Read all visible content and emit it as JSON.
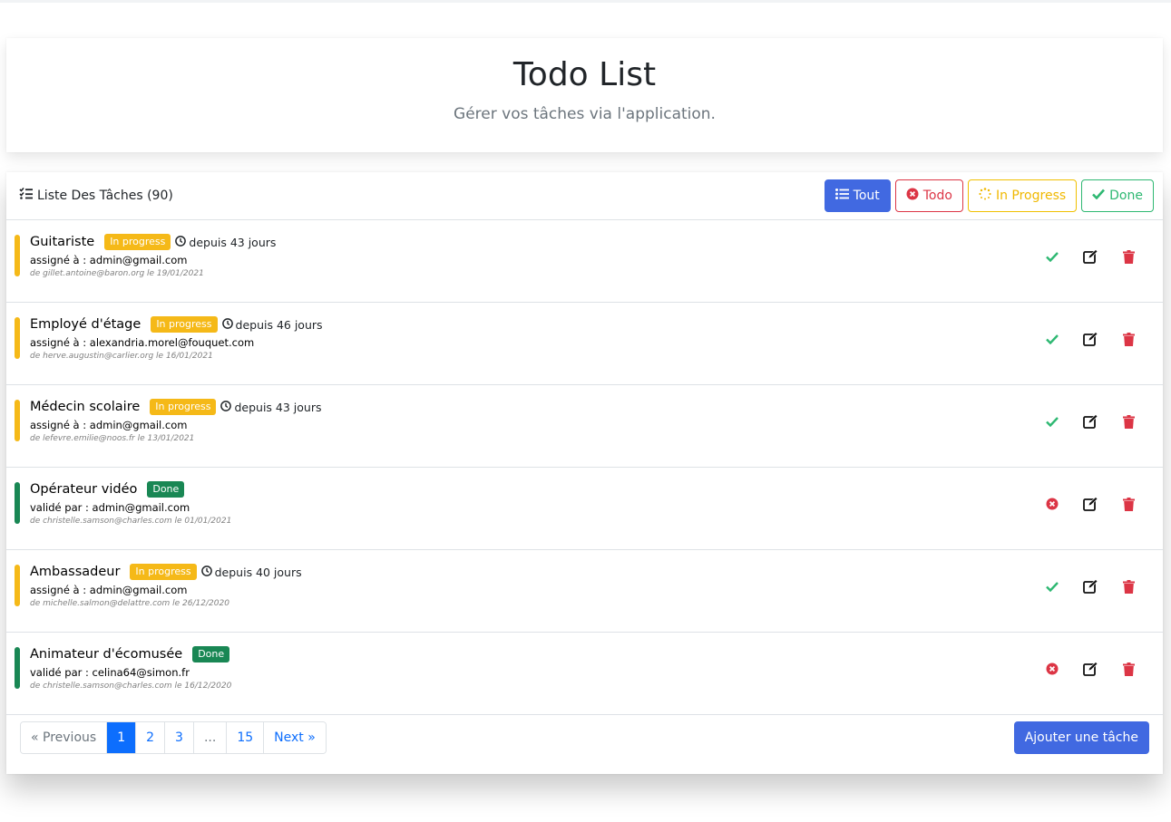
{
  "header": {
    "title": "Todo List",
    "subtitle": "Gérer vos tâches via l'application."
  },
  "tasks_panel": {
    "title": "Liste Des Tâches (90)",
    "title_icon": "tasks-list-icon",
    "filters": {
      "all": "Tout",
      "todo": "Todo",
      "in_progress": "In Progress",
      "done": "Done"
    },
    "colors": {
      "primary": "#4169e1",
      "danger": "#dc3545",
      "warning": "#f5b918",
      "success": "#198754",
      "check": "#2eb872"
    }
  },
  "tasks": [
    {
      "title": "Guitariste",
      "status": "In progress",
      "since": "depuis 43 jours",
      "assignment": "assigné à : admin@gmail.com",
      "meta": "de gillet.antoine@baron.org le 19/01/2021"
    },
    {
      "title": "Employé d'étage",
      "status": "In progress",
      "since": "depuis 46 jours",
      "assignment": "assigné à : alexandria.morel@fouquet.com",
      "meta": "de herve.augustin@carlier.org le 16/01/2021"
    },
    {
      "title": "Médecin scolaire",
      "status": "In progress",
      "since": "depuis 43 jours",
      "assignment": "assigné à : admin@gmail.com",
      "meta": "de lefevre.emilie@noos.fr le 13/01/2021"
    },
    {
      "title": "Opérateur vidéo",
      "status": "Done",
      "assignment": "validé par : admin@gmail.com",
      "meta": "de christelle.samson@charles.com le 01/01/2021"
    },
    {
      "title": "Ambassadeur",
      "status": "In progress",
      "since": "depuis 40 jours",
      "assignment": "assigné à : admin@gmail.com",
      "meta": "de michelle.salmon@delattre.com le 26/12/2020"
    },
    {
      "title": "Animateur d'écomusée",
      "status": "Done",
      "assignment": "validé par : celina64@simon.fr",
      "meta": "de christelle.samson@charles.com le 16/12/2020"
    }
  ],
  "pagination": {
    "previous": "« Previous",
    "pages": [
      "1",
      "2",
      "3",
      "...",
      "15"
    ],
    "active_page": "1",
    "next": "Next »"
  },
  "add_button": "Ajouter une tâche"
}
